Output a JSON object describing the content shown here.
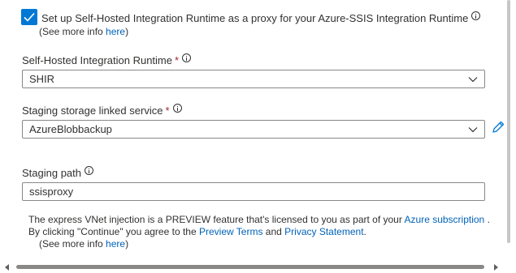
{
  "proxy": {
    "checked": true,
    "label": "Set up Self-Hosted Integration Runtime as a proxy for your Azure-SSIS Integration Runtime",
    "more_info_prefix": "(See more info ",
    "more_info_link": "here",
    "more_info_suffix": ")"
  },
  "shir_field": {
    "label": "Self-Hosted Integration Runtime",
    "required_mark": "*",
    "value": "SHIR"
  },
  "staging_linked_service": {
    "label": "Staging storage linked service",
    "required_mark": "*",
    "value": "AzureBlobbackup"
  },
  "staging_path": {
    "label": "Staging path",
    "value": "ssisproxy"
  },
  "notice": {
    "line1_text": "The express VNet injection is a PREVIEW feature that's licensed to you as part of your ",
    "line1_link": "Azure subscription",
    "line1_end": " .",
    "line2_prefix": "By clicking \"Continue\" you agree to the ",
    "line2_link1": "Preview Terms",
    "line2_and": " and ",
    "line2_link2": "Privacy Statement",
    "line2_end": ".",
    "more_info_prefix": "(See more info ",
    "more_info_link": "here",
    "more_info_suffix": ")"
  },
  "icons": {
    "checkbox": "checkmark-icon",
    "info": "info-icon",
    "dropdown": "chevron-down-icon",
    "edit": "pencil-icon"
  },
  "colors": {
    "accent": "#0078d4",
    "link": "#0062b8",
    "required": "#a4262c"
  }
}
